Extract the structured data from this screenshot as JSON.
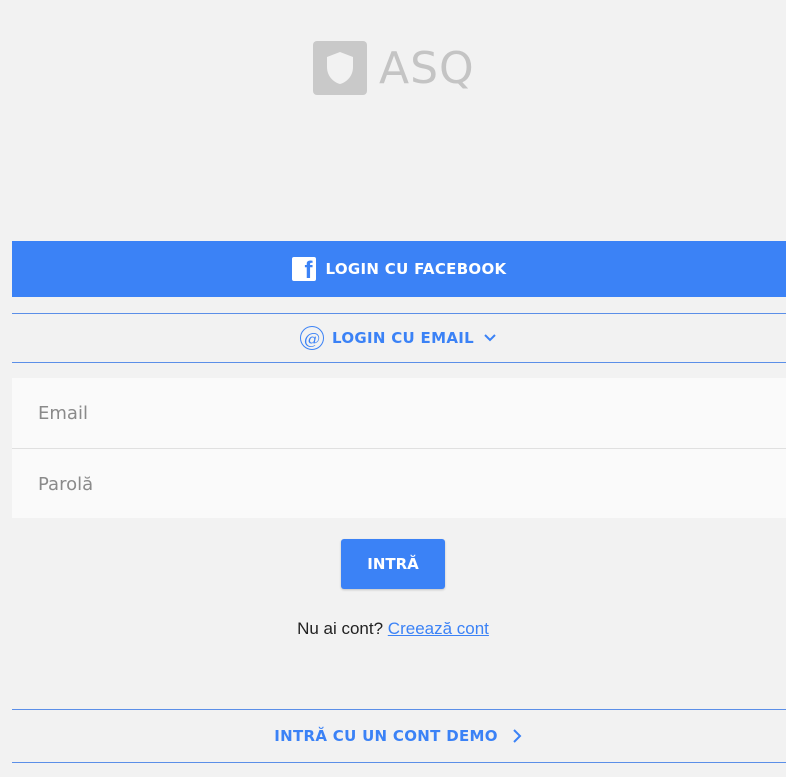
{
  "brand": {
    "name": "ASQ",
    "logo_icon": "shield-icon"
  },
  "facebook_login": {
    "label": "LOGIN CU FACEBOOK",
    "icon": "facebook-icon",
    "color": "#3b82f6"
  },
  "email_login_toggle": {
    "label": "LOGIN CU EMAIL",
    "icon": "at-sign-icon",
    "chevron": "chevron-down-icon"
  },
  "form": {
    "email": {
      "value": "",
      "placeholder": "Email"
    },
    "password": {
      "value": "",
      "placeholder": "Parolă"
    },
    "submit_label": "INTRĂ"
  },
  "signup": {
    "prompt": "Nu ai cont?",
    "link_label": "Creează cont"
  },
  "demo": {
    "label": "INTRĂ CU UN CONT DEMO",
    "chevron": "chevron-right-icon"
  },
  "colors": {
    "accent": "#3b82f6",
    "background": "#f2f2f2",
    "logo_gray": "#c4c4c4"
  }
}
